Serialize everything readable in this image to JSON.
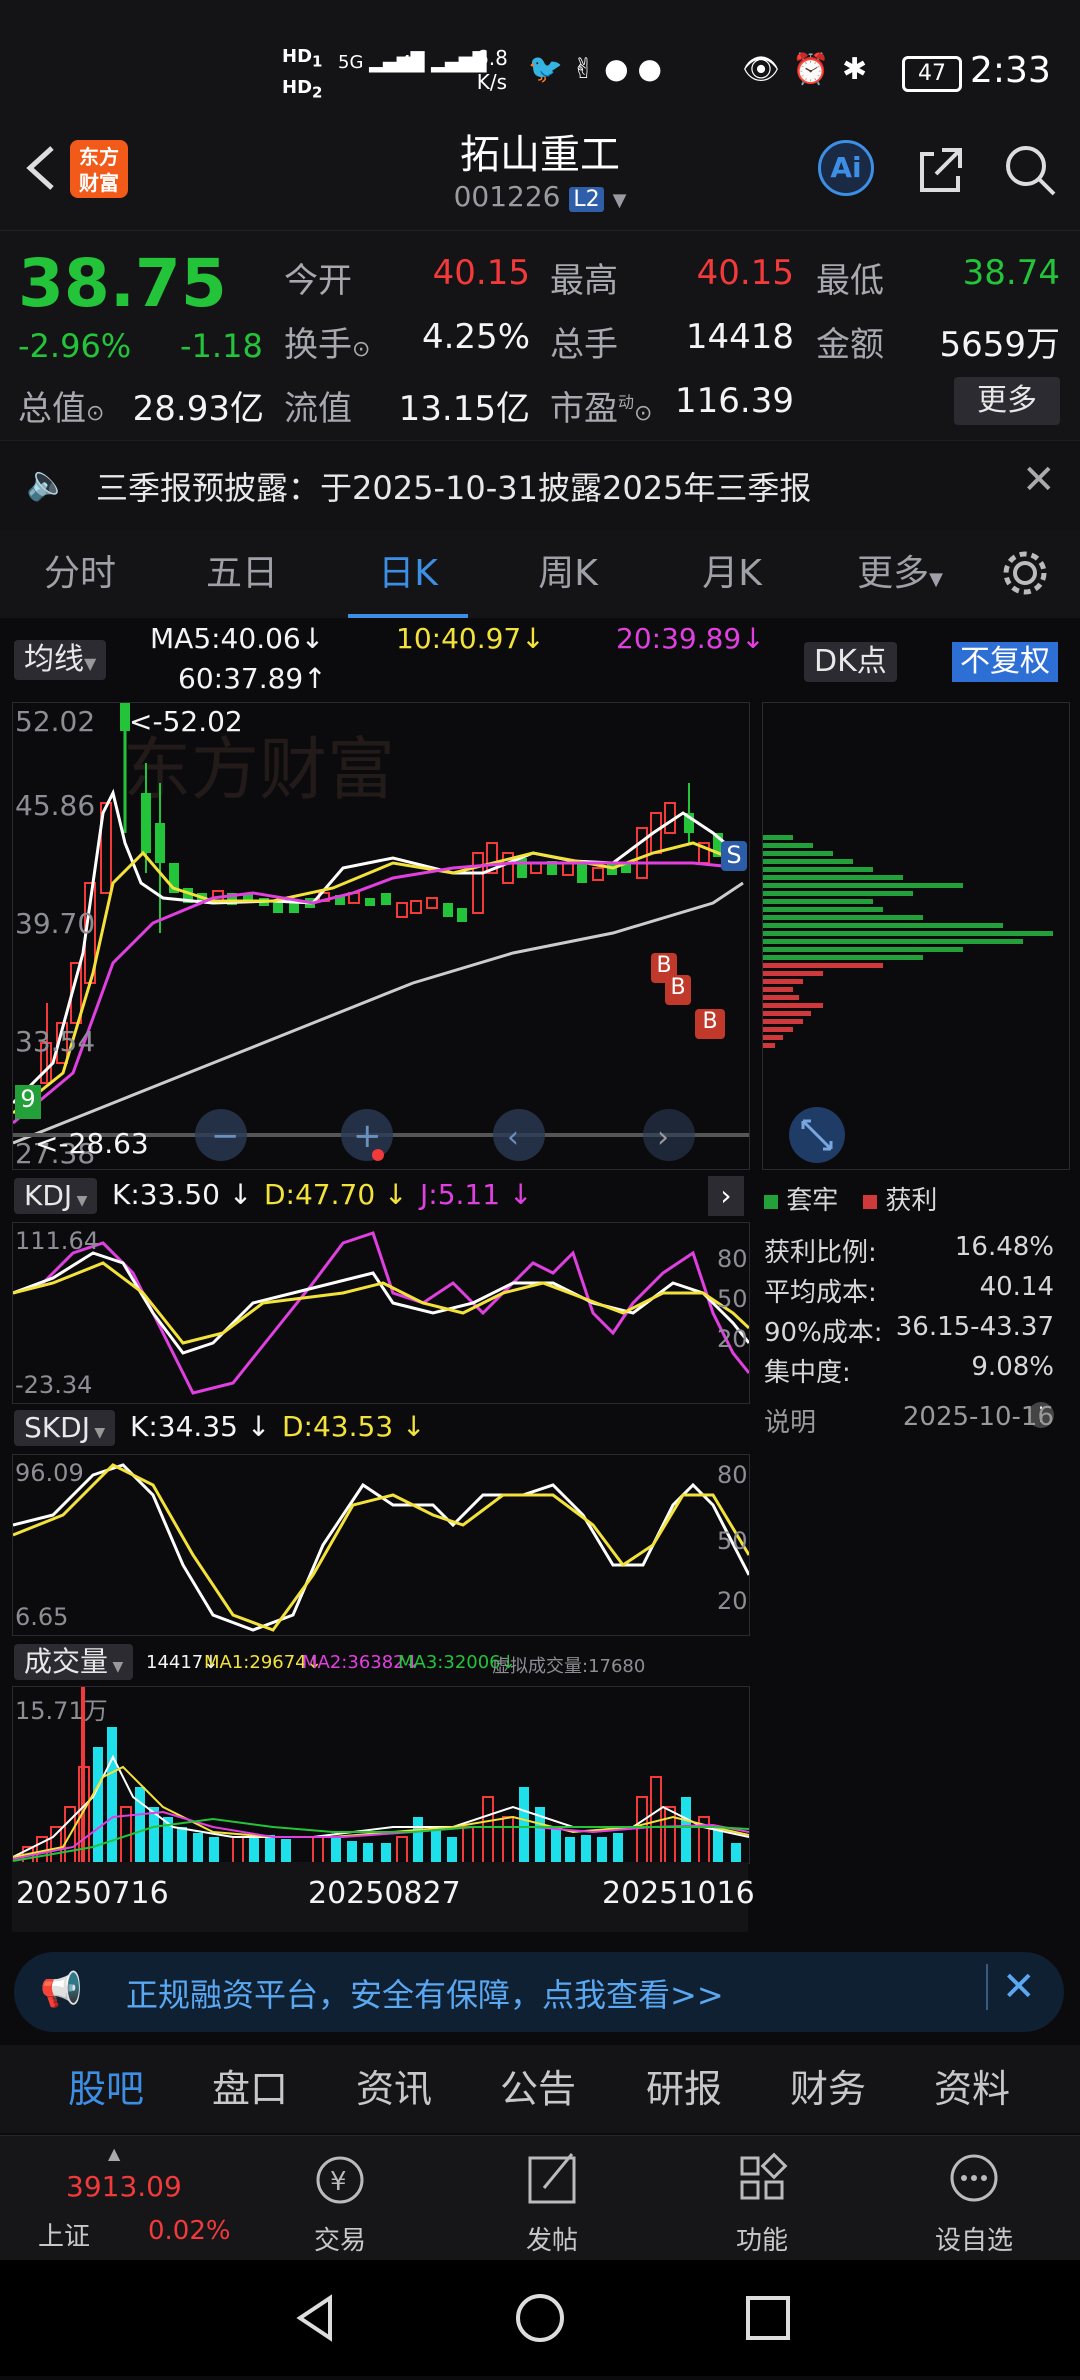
{
  "status_bar": {
    "network_speed": "6.8",
    "network_unit": "K/s",
    "battery": "47",
    "time": "2:33"
  },
  "header": {
    "title": "拓山重工",
    "code": "001226",
    "level_badge": "L2",
    "logo_text_1": "东方",
    "logo_text_2": "财富",
    "ai_label": "Ai"
  },
  "quote": {
    "price": "38.75",
    "change_pct": "-2.96%",
    "change": "-1.18",
    "open_label": "今开",
    "open": "40.15",
    "high_label": "最高",
    "high": "40.15",
    "low_label": "最低",
    "low": "38.74",
    "turnover_label": "换手",
    "turnover": "4.25%",
    "volume_label": "总手",
    "volume": "14418",
    "amount_label": "金额",
    "amount": "5659万",
    "mktcap_label": "总值",
    "mktcap": "28.93亿",
    "float_label": "流值",
    "float": "13.15亿",
    "pe_label": "市盈",
    "pe_sup": "动",
    "pe": "116.39",
    "more_button": "更多"
  },
  "notice": {
    "text": "三季报预披露：于2025-10-31披露2025年三季报"
  },
  "tabs": [
    "分时",
    "五日",
    "日K",
    "周K",
    "月K",
    "更多"
  ],
  "active_tab": "日K",
  "ma_bar": {
    "selector": "均线",
    "ma5": "MA5:40.06",
    "ma10": "10:40.97",
    "ma20": "20:39.89",
    "ma60": "60:37.89",
    "dk": "DK点",
    "adjust": "不复权"
  },
  "kline": {
    "y_max_label": "52.02",
    "y_2": "45.86",
    "y_3": "39.70",
    "y_4": "33.54",
    "y_min_label": "27.38",
    "high_marker": "<-52.02",
    "low_marker": "<-28.63",
    "badge_9": "9",
    "marker_s": "S",
    "marker_b": "B"
  },
  "chip": {
    "legend_hold": "套牢",
    "legend_profit": "获利",
    "rows": [
      {
        "label": "获利比例:",
        "value": "16.48%"
      },
      {
        "label": "平均成本:",
        "value": "40.14"
      },
      {
        "label": "90%成本:",
        "value": "36.15-43.37"
      },
      {
        "label": "集中度:",
        "value": "9.08%"
      }
    ],
    "note_label": "说明",
    "date": "2025-10-16"
  },
  "kdj": {
    "name": "KDJ",
    "k": "K:33.50",
    "d": "D:47.70",
    "j": "J:5.11",
    "top": "111.64",
    "bottom": "-23.34",
    "r80": "80",
    "r50": "50",
    "r20": "20"
  },
  "skdj": {
    "name": "SKDJ",
    "k": "K:34.35",
    "d": "D:43.53",
    "top": "96.09",
    "bottom": "6.65",
    "r80": "80",
    "r50": "50",
    "r20": "20"
  },
  "volume_panel": {
    "name": "成交量",
    "v": "14417",
    "ma1": "MA1:29674",
    "ma2": "MA2:36382",
    "ma3": "MA3:32006",
    "virtual": "虚拟成交量:17680",
    "top": "15.71万",
    "dates": [
      "20250716",
      "20250827",
      "20251016"
    ]
  },
  "banner": {
    "text": "正规融资平台，安全有保障，点我查看>>"
  },
  "bottom_tabs": [
    "股吧",
    "盘口",
    "资讯",
    "公告",
    "研报",
    "财务",
    "资料"
  ],
  "bottom_bar": {
    "index_value": "3913.09",
    "index_name": "上证",
    "index_pct": "0.02%",
    "trade": "交易",
    "post": "发帖",
    "function": "功能",
    "watch": "设自选"
  },
  "colors": {
    "up": "#f23a3a",
    "down": "#23c43a",
    "accent": "#3d8fe6",
    "ma10": "#f2e23a",
    "ma20": "#e040e0"
  }
}
